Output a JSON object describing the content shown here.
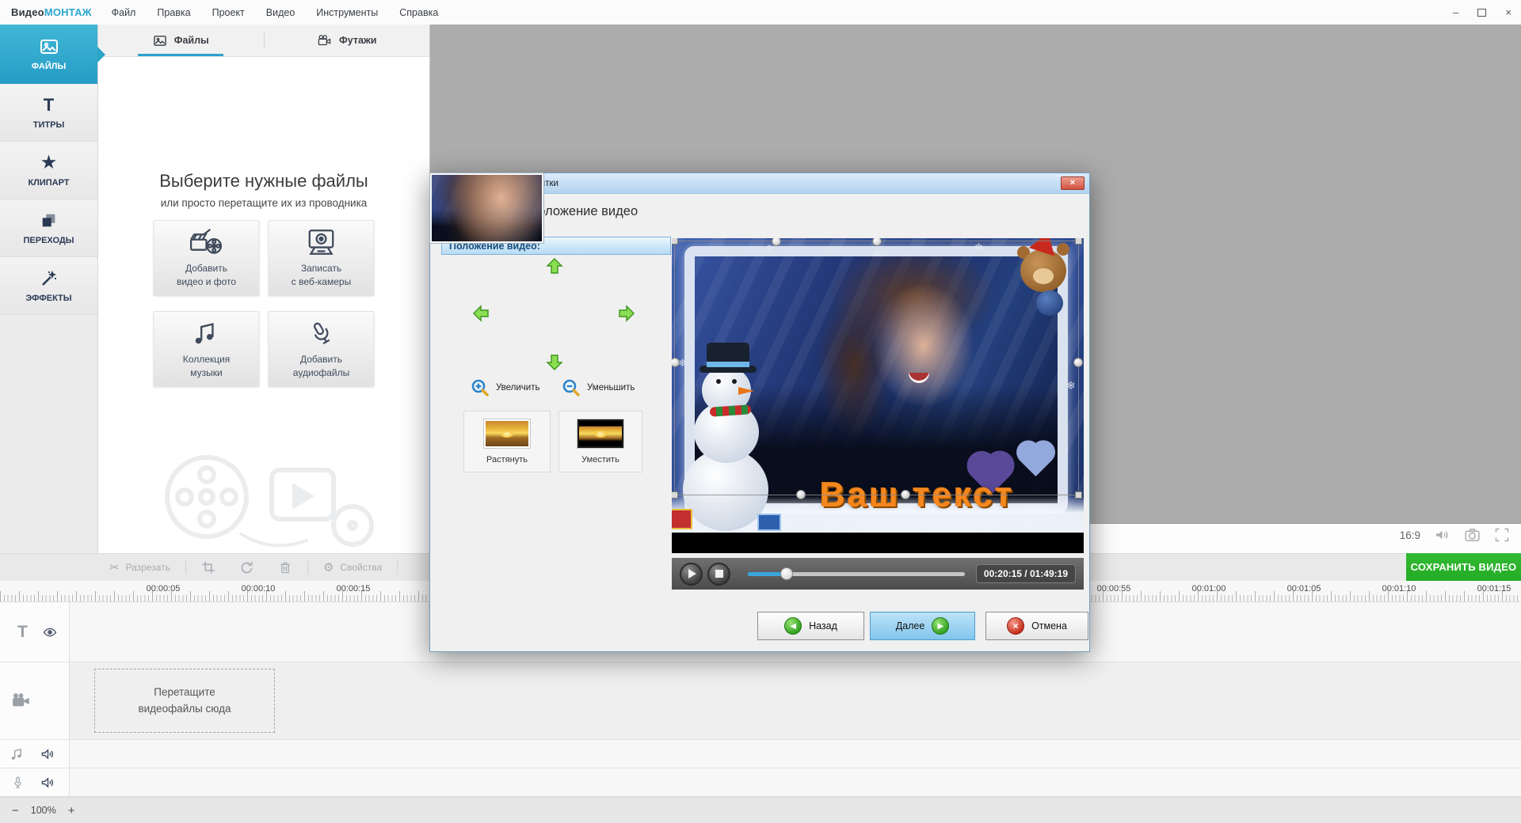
{
  "brand": {
    "part1": "Видео",
    "part2": "МОНТАЖ"
  },
  "menubar": {
    "items": [
      "Файл",
      "Правка",
      "Проект",
      "Видео",
      "Инструменты",
      "Справка"
    ]
  },
  "icons": {
    "minimize": "–",
    "close": "×",
    "scissors": "✂",
    "gear": "⚙",
    "star": "★",
    "titles_glyph": "T",
    "snowflake": "❄",
    "back_arrow": "◀",
    "next_arrow": "▶",
    "cancel_x": "×"
  },
  "sidebar": {
    "items": [
      {
        "label": "ФАЙЛЫ"
      },
      {
        "label": "ТИТРЫ"
      },
      {
        "label": "КЛИПАРТ"
      },
      {
        "label": "ПЕРЕХОДЫ"
      },
      {
        "label": "ЭФФЕКТЫ"
      }
    ]
  },
  "files_panel": {
    "tabs": [
      {
        "label": "Файлы"
      },
      {
        "label": "Футажи"
      }
    ],
    "heading": "Выберите нужные файлы",
    "subheading": "или просто перетащите их из проводника",
    "actions": [
      {
        "line1": "Добавить",
        "line2": "видео и фото"
      },
      {
        "line1": "Записать",
        "line2": "с веб-камеры"
      },
      {
        "line1": "Коллекция",
        "line2": "музыки"
      },
      {
        "line1": "Добавить",
        "line2": "аудиофайлы"
      }
    ]
  },
  "toolbar": {
    "cut": "Разрезать",
    "properties": "Свойства"
  },
  "preview_controls": {
    "aspect": "16:9"
  },
  "save_button": {
    "label": "СОХРАНИТЬ ВИДЕО",
    "color": "#2db52d"
  },
  "timeline": {
    "ticks": [
      "00:00:05",
      "00:00:10",
      "00:00:15",
      "00:00:55",
      "00:01:00",
      "00:01:05",
      "00:01:10",
      "00:01:15"
    ],
    "drop_line1": "Перетащите",
    "drop_line2": "видеофайлы сюда"
  },
  "statusbar": {
    "zoom_out": "−",
    "zoom_level": "100%",
    "zoom_in": "+"
  },
  "dialog": {
    "title": "Создание видеооткрытки",
    "header": "Задайте положение видео",
    "position_panel": {
      "title": "Положение видео:",
      "zoom_in": "Увеличить",
      "zoom_out": "Уменьшить",
      "stretch": "Растянуть",
      "fit": "Уместить"
    },
    "preview": {
      "caption": "Ваш текст"
    },
    "player": {
      "time": "00:20:15 / 01:49:19"
    },
    "buttons": {
      "back": "Назад",
      "next": "Далее",
      "cancel": "Отмена"
    }
  },
  "colors": {
    "accent": "#2aa7cf",
    "save_green": "#2db52d",
    "caption_orange": "#f5871f",
    "next_button": "#9bd3f2"
  }
}
